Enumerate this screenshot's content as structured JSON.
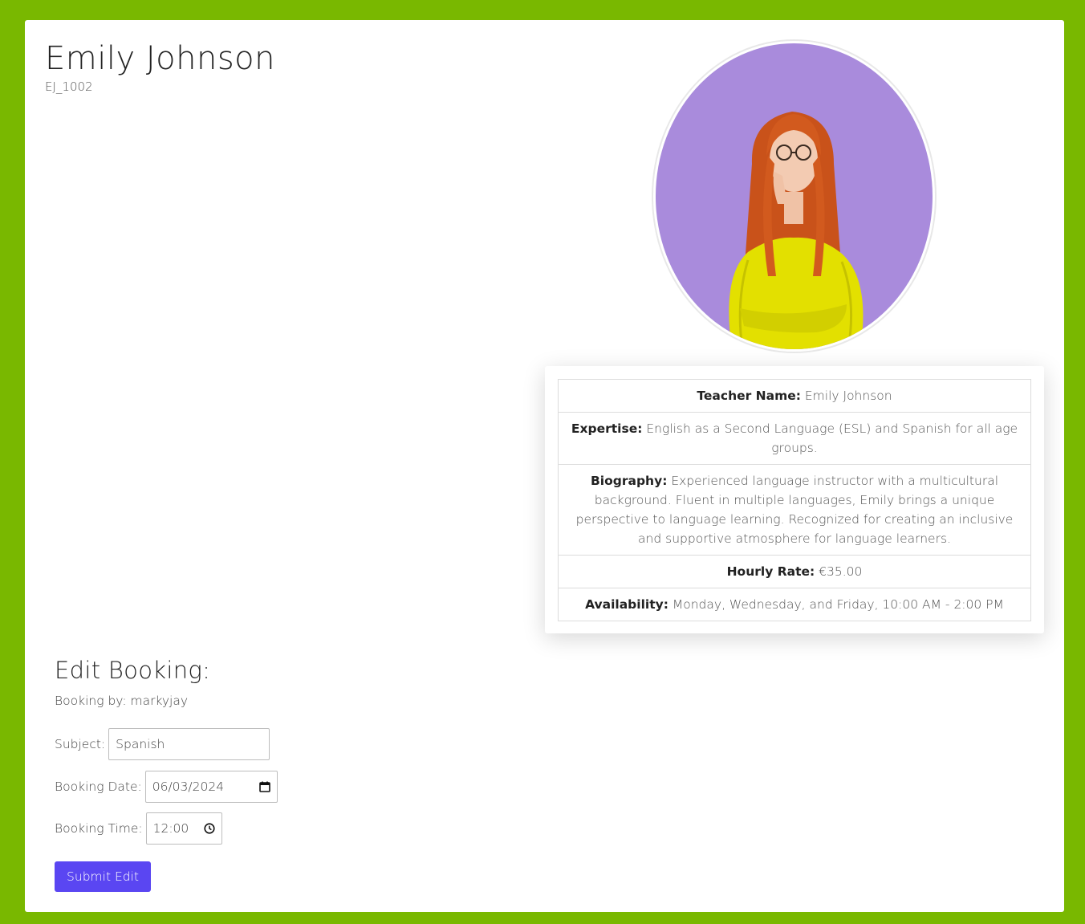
{
  "teacher": {
    "name": "Emily Johnson",
    "id": "EJ_1002"
  },
  "details": {
    "teacher_name_label": "Teacher Name:",
    "teacher_name_value": "Emily Johnson",
    "expertise_label": "Expertise:",
    "expertise_value": "English as a Second Language (ESL) and Spanish for all age groups.",
    "biography_label": "Biography:",
    "biography_value": "Experienced language instructor with a multicultural background. Fluent in multiple languages, Emily brings a unique perspective to language learning. Recognized for creating an inclusive and supportive atmosphere for language learners.",
    "rate_label": "Hourly Rate:",
    "rate_value": "€35.00",
    "availability_label": "Availability:",
    "availability_value": "Monday, Wednesday, and Friday, 10:00 AM - 2:00 PM"
  },
  "booking": {
    "heading": "Edit Booking:",
    "booked_by": "Booking by: markyjay",
    "subject_label": "Subject:",
    "subject_value": "Spanish",
    "date_label": "Booking Date:",
    "date_value": "06/03/2024",
    "time_label": "Booking Time:",
    "time_value": "12:00",
    "submit_label": "Submit Edit"
  },
  "colors": {
    "page_background": "#79b800",
    "submit_button": "#5a46f2",
    "photo_background": "#a98bdc",
    "sweater": "#e3e000",
    "hair": "#d25a1e"
  },
  "icons": {
    "date": "calendar-icon",
    "time": "clock-icon"
  }
}
